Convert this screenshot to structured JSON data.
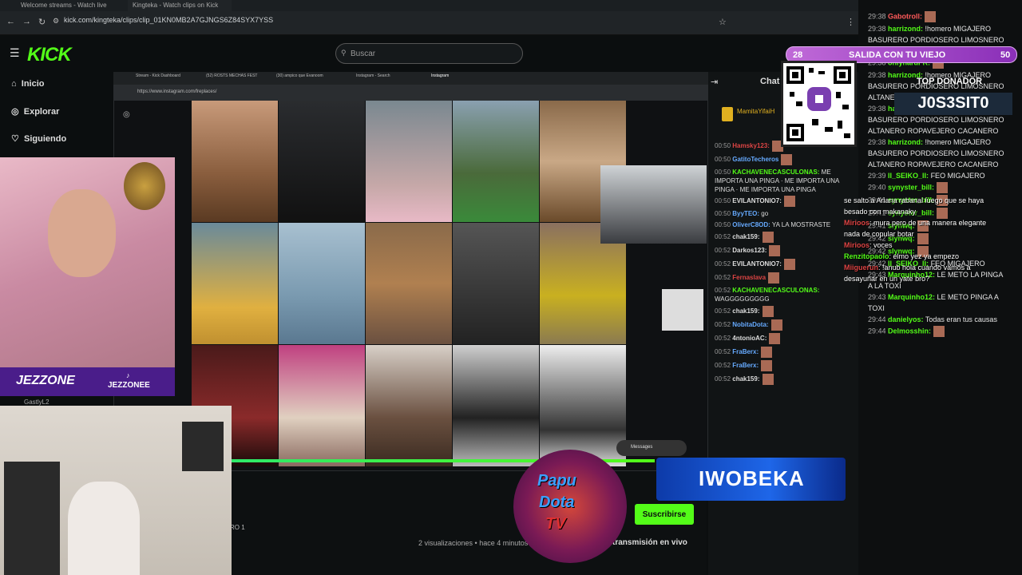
{
  "browser": {
    "tabs": [
      "Welcome streams - Watch live",
      "Kingteka - Watch clips on Kick"
    ],
    "url": "kick.com/kingteka/clips/clip_01KN0MB2A7GJNGS6Z84SYX7YSS"
  },
  "kick": {
    "logo": "KICK",
    "search_placeholder": "Buscar",
    "nav": [
      {
        "icon": "home-icon",
        "label": "Inicio"
      },
      {
        "icon": "compass-icon",
        "label": "Explorar"
      },
      {
        "icon": "heart-icon",
        "label": "Siguiendo"
      }
    ],
    "subscribe_label": "Suscribirse",
    "views": "2 visualizaciones • hace 4 minutos",
    "live_label": "transmisión en vivo",
    "chat_title": "Chat"
  },
  "inner_browser": {
    "tabs": [
      "Stream - Kick Dashboard",
      "(52) ROSTS MECHAS FEST",
      "(30) ampico que Evanoom",
      "Instagram - Search",
      "Instagram"
    ],
    "url": "https://www.instagram.com/freplaces/",
    "messages_label": "Messages"
  },
  "kick_chat": [
    {
      "time": "",
      "user": "MamitaYifaiH",
      "color": "#e0b020",
      "text": ""
    },
    {
      "time": "00:50",
      "user": "Hamsky123:",
      "color": "#d44",
      "text": ""
    },
    {
      "time": "00:50",
      "user": "GatitoTecheros",
      "color": "#6af",
      "text": ""
    },
    {
      "time": "00:50",
      "user": "KACHAVENECASCULONAS:",
      "color": "#53fc18",
      "text": "ME IMPORTA UNA PINGA · ME IMPORTA UNA PINGA · ME IMPORTA UNA PINGA"
    },
    {
      "time": "00:50",
      "user": "EVILANTONIO7:",
      "color": "#ddd",
      "text": ""
    },
    {
      "time": "00:50",
      "user": "ByyTEO:",
      "color": "#6af",
      "text": "go"
    },
    {
      "time": "00:50",
      "user": "OliverC8OD:",
      "color": "#6af",
      "text": "YA LA MOSTRASTE"
    },
    {
      "time": "00:52",
      "user": "chak159:",
      "color": "#ddd",
      "text": ""
    },
    {
      "time": "00:52",
      "user": "Darkos123:",
      "color": "#ddd",
      "text": ""
    },
    {
      "time": "00:52",
      "user": "EVILANTONIO7:",
      "color": "#ddd",
      "text": ""
    },
    {
      "time": "00:52",
      "user": "Fernaslava",
      "color": "#d44",
      "text": ""
    },
    {
      "time": "00:52",
      "user": "KACHAVENECASCULONAS:",
      "color": "#53fc18",
      "text": "WAGGGGGGGGG"
    },
    {
      "time": "00:52",
      "user": "chak159:",
      "color": "#ddd",
      "text": ""
    },
    {
      "time": "00:52",
      "user": "NobitaDota:",
      "color": "#6af",
      "text": ""
    },
    {
      "time": "00:52",
      "user": "4ntonioAC:",
      "color": "#ddd",
      "text": ""
    },
    {
      "time": "00:52",
      "user": "FraBerx:",
      "color": "#6af",
      "text": ""
    },
    {
      "time": "00:52",
      "user": "FraBerx:",
      "color": "#6af",
      "text": ""
    },
    {
      "time": "00:52",
      "user": "chak159:",
      "color": "#ddd",
      "text": ""
    }
  ],
  "overlay": {
    "goal": {
      "left": "28",
      "label": "SALIDA CON TU VIEJO",
      "right": "50"
    },
    "top_donor_label": "TOP DONADOR",
    "top_donor_name": "J0S3SIT0",
    "banner_name": "IWOBEKA",
    "papu_lines": [
      "Papu",
      "Dota",
      "TV"
    ],
    "streamer_logo": "JEZZONE",
    "streamer_handle": "JEZZONEE",
    "streamer_sub": "GastlyL2",
    "chat": [
      {
        "user": "",
        "color": "#fff",
        "text": "se salto a Ariana rabanal luego que se haya"
      },
      {
        "user": "",
        "color": "#fff",
        "text": "besado con makanaky"
      },
      {
        "user": "Mirioos",
        "color": "#d44",
        "text": ": mura pero de una manera elegante"
      },
      {
        "user": "",
        "color": "#fff",
        "text": "nada de copular botar"
      },
      {
        "user": "Mirioos",
        "color": "#d44",
        "text": ": voces"
      },
      {
        "user": "Renzitopaolo",
        "color": "#53fc18",
        "text": ": elmo yez ya empezo"
      },
      {
        "user": "Miiguerun",
        "color": "#d44",
        "text": ": !anub hola cuando vamos a"
      },
      {
        "user": "",
        "color": "#fff",
        "text": "desayunar en un yate bro?"
      }
    ]
  },
  "right_chat": [
    {
      "time": "29:38",
      "user": "Gabotroll:",
      "color": "#ff5a5a",
      "text": ""
    },
    {
      "time": "29:38",
      "user": "harrizond:",
      "color": "#53fc18",
      "text": "!homero MIGAJERO"
    },
    {
      "time": "",
      "user": "",
      "color": "#fff",
      "text": "BASURERO PORDIOSERO LIMOSNERO"
    },
    {
      "time": "",
      "user": "",
      "color": "#fff",
      "text": "ALTANERO ROPAVEJERO CACANERO"
    },
    {
      "time": "29:38",
      "user": "onlyhardFR:",
      "color": "#53fc18",
      "text": ""
    },
    {
      "time": "29:38",
      "user": "harrizond:",
      "color": "#53fc18",
      "text": "!homero MIGAJERO"
    },
    {
      "time": "",
      "user": "",
      "color": "#fff",
      "text": "BASURERO PORDIOSERO LIMOSNERO"
    },
    {
      "time": "",
      "user": "",
      "color": "#fff",
      "text": "ALTANERO ROPAVEJERO CACANERO"
    },
    {
      "time": "29:38",
      "user": "harrizond:",
      "color": "#53fc18",
      "text": "!homero MIGAJERO"
    },
    {
      "time": "",
      "user": "",
      "color": "#fff",
      "text": "BASURERO PORDIOSERO LIMOSNERO"
    },
    {
      "time": "",
      "user": "",
      "color": "#fff",
      "text": "ALTANERO ROPAVEJERO CACANERO"
    },
    {
      "time": "29:38",
      "user": "harrizond:",
      "color": "#53fc18",
      "text": "!homero MIGAJERO"
    },
    {
      "time": "",
      "user": "",
      "color": "#fff",
      "text": "BASURERO PORDIOSERO LIMOSNERO"
    },
    {
      "time": "",
      "user": "",
      "color": "#fff",
      "text": "ALTANERO ROPAVEJERO CACANERO"
    },
    {
      "time": "29:39",
      "user": "II_SEIKO_II:",
      "color": "#53fc18",
      "text": "FEO MIGAJERO"
    },
    {
      "time": "29:40",
      "user": "synyster_bill:",
      "color": "#53fc18",
      "text": ""
    },
    {
      "time": "29:41",
      "user": "synyster_bill:",
      "color": "#53fc18",
      "text": ""
    },
    {
      "time": "29:41",
      "user": "synyster_bill:",
      "color": "#53fc18",
      "text": ""
    },
    {
      "time": "29:41",
      "user": "slynwq:",
      "color": "#53fc18",
      "text": ""
    },
    {
      "time": "29:42",
      "user": "slynwq:",
      "color": "#53fc18",
      "text": ""
    },
    {
      "time": "29:42",
      "user": "slynwq:",
      "color": "#53fc18",
      "text": ""
    },
    {
      "time": "29:42",
      "user": "II_SEIKO_II:",
      "color": "#53fc18",
      "text": "FEO MIGAJERO"
    },
    {
      "time": "29:43",
      "user": "Marquinho12:",
      "color": "#53fc18",
      "text": "LE METO LA PINGA"
    },
    {
      "time": "",
      "user": "",
      "color": "#fff",
      "text": "A LA TOXI"
    },
    {
      "time": "29:43",
      "user": "Marquinho12:",
      "color": "#53fc18",
      "text": "LE METO PINGA A"
    },
    {
      "time": "",
      "user": "",
      "color": "#fff",
      "text": "TOXI"
    },
    {
      "time": "29:44",
      "user": "danielyos:",
      "color": "#53fc18",
      "text": "Todas eran tus causas"
    },
    {
      "time": "29:44",
      "user": "Delmosshin:",
      "color": "#53fc18",
      "text": ""
    }
  ]
}
